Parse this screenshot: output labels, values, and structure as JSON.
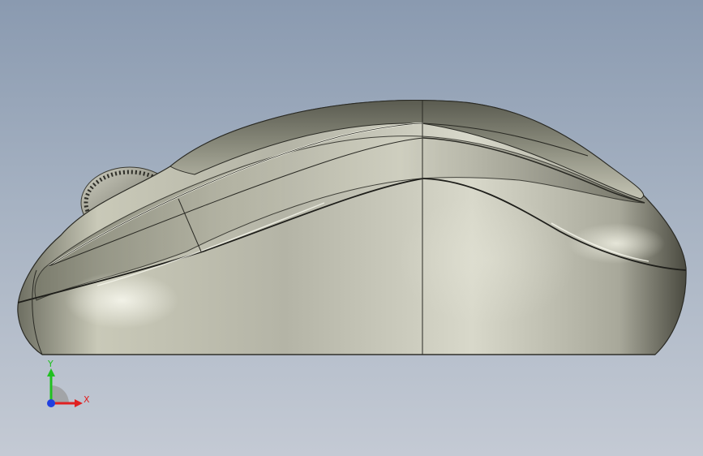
{
  "viewport": {
    "background_top": "#8a9ab0",
    "background_bottom": "#c4cad4",
    "model_name": "computer-mouse-side-view"
  },
  "triad": {
    "x_label": "X",
    "y_label": "Y",
    "x_color": "#e02020",
    "y_color": "#20c020",
    "z_color": "#2040e0"
  }
}
